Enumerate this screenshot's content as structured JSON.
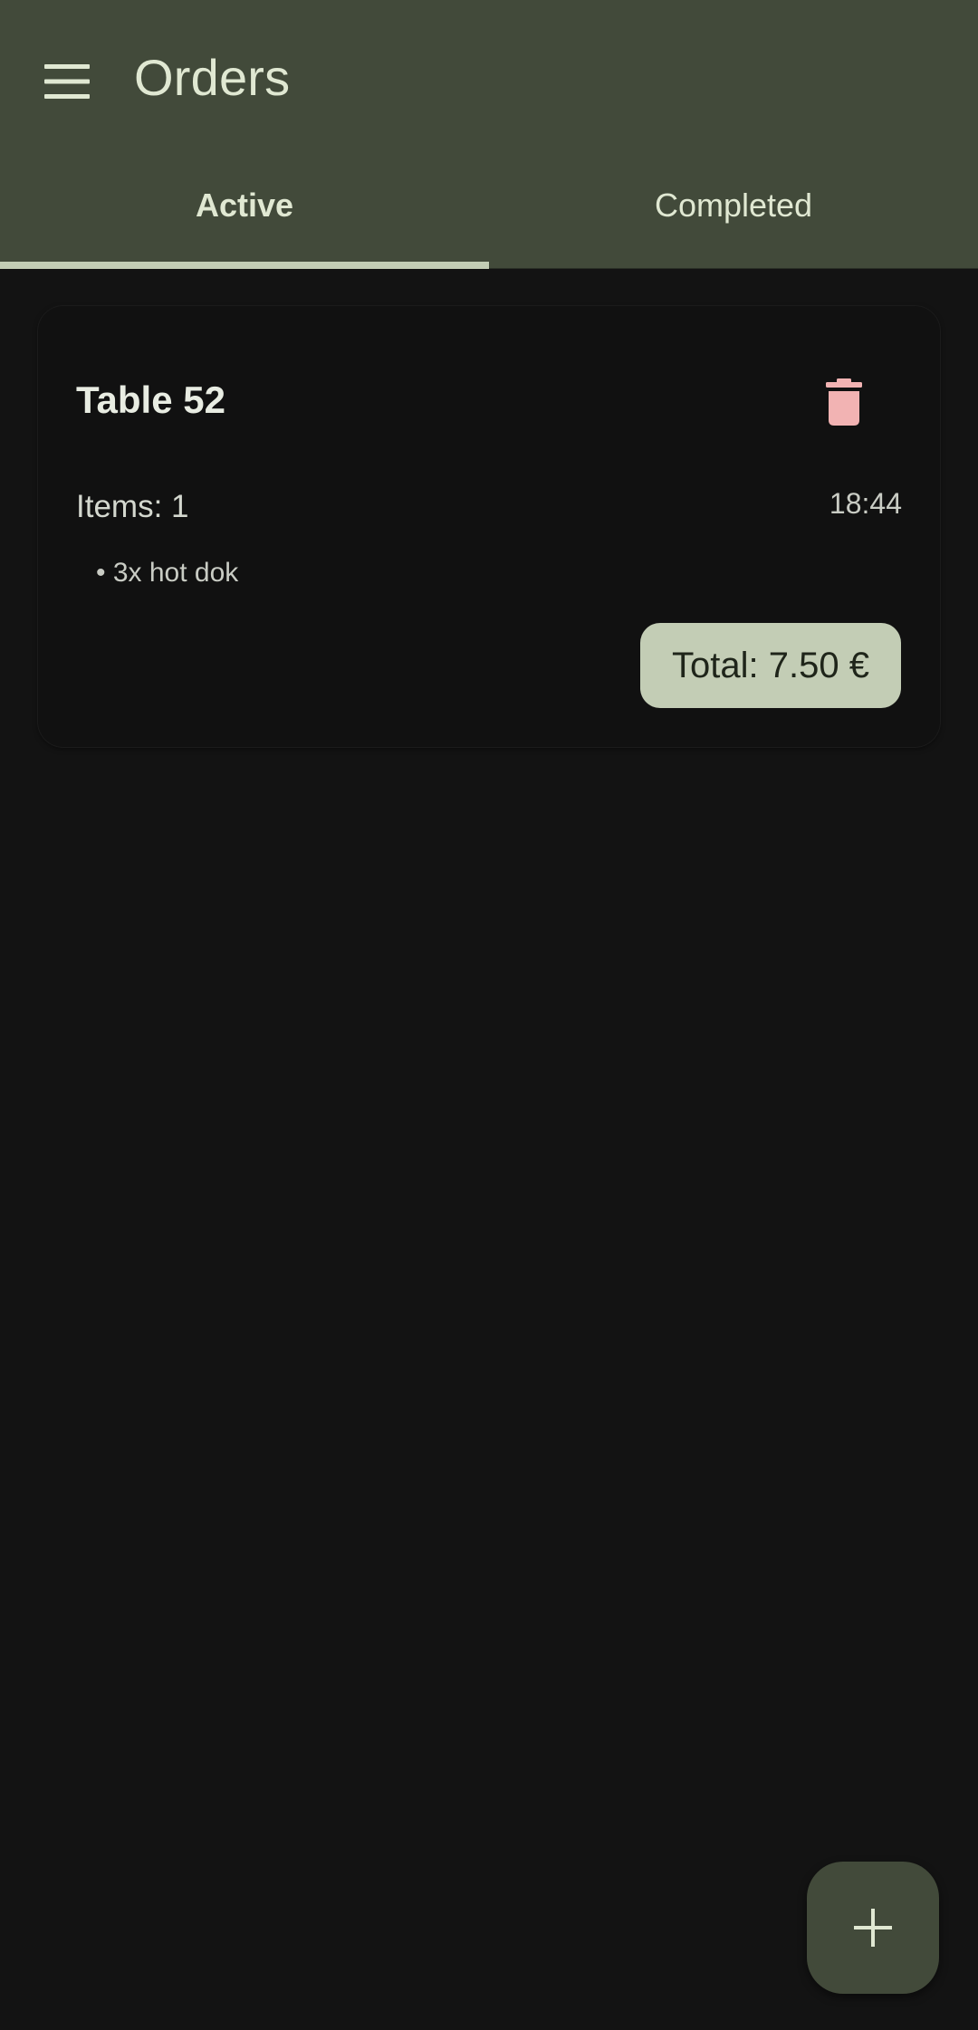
{
  "app_bar": {
    "title": "Orders",
    "menu_icon": "hamburger-menu-icon"
  },
  "tabs": [
    {
      "label": "Active",
      "selected": true
    },
    {
      "label": "Completed",
      "selected": false
    }
  ],
  "orders": [
    {
      "title": "Table 52",
      "items_count": "Items: 1",
      "time": "18:44",
      "items": [
        "• 3x hot dok"
      ],
      "total": "Total: 7.50 €",
      "delete_icon": "trash-icon"
    }
  ],
  "fab": {
    "icon": "plus-icon"
  },
  "colors": {
    "surface": "#131313",
    "app_bar": "#424a3a",
    "accent": "#c3cdb5",
    "on_app_bar": "#e0e8d2",
    "delete": "#f2b3b3"
  }
}
